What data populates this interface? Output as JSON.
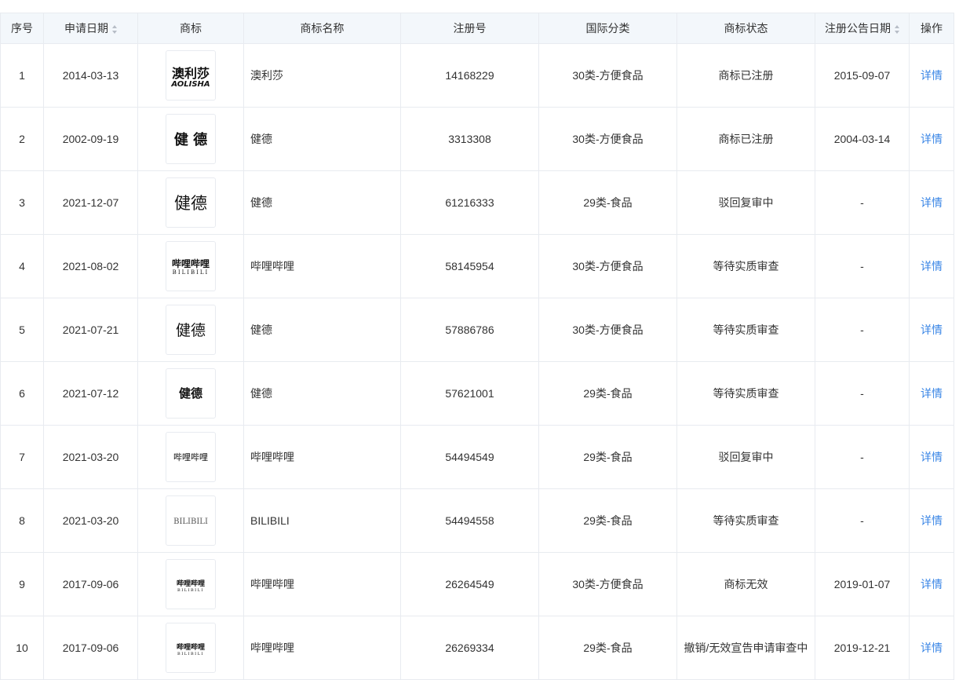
{
  "table": {
    "headers": {
      "index": "序号",
      "apply_date": "申请日期",
      "logo": "商标",
      "name": "商标名称",
      "reg_no": "注册号",
      "class": "国际分类",
      "status": "商标状态",
      "notice_date": "注册公告日期",
      "action": "操作"
    },
    "rows": [
      {
        "index": "1",
        "apply_date": "2014-03-13",
        "logo": {
          "icon": "aolisha-logo",
          "line1": "澳利莎",
          "line2": "AOLISHA"
        },
        "name": "澳利莎",
        "reg_no": "14168229",
        "class": "30类-方便食品",
        "status": "商标已注册",
        "notice_date": "2015-09-07",
        "action": "详情"
      },
      {
        "index": "2",
        "apply_date": "2002-09-19",
        "logo": {
          "icon": "jiande-bold-spaced-logo",
          "line1": "健 德",
          "line2": ""
        },
        "name": "健德",
        "reg_no": "3313308",
        "class": "30类-方便食品",
        "status": "商标已注册",
        "notice_date": "2004-03-14",
        "action": "详情"
      },
      {
        "index": "3",
        "apply_date": "2021-12-07",
        "logo": {
          "icon": "jiande-large-logo",
          "line1": "健德",
          "line2": ""
        },
        "name": "健德",
        "reg_no": "61216333",
        "class": "29类-食品",
        "status": "驳回复审中",
        "notice_date": "-",
        "action": "详情"
      },
      {
        "index": "4",
        "apply_date": "2021-08-02",
        "logo": {
          "icon": "bilibili-bold-logo",
          "line1": "哔哩哔哩",
          "line2": "BILIBILI"
        },
        "name": "哔哩哔哩",
        "reg_no": "58145954",
        "class": "30类-方便食品",
        "status": "等待实质审查",
        "notice_date": "-",
        "action": "详情"
      },
      {
        "index": "5",
        "apply_date": "2021-07-21",
        "logo": {
          "icon": "jiande-serif-logo",
          "line1": "健德",
          "line2": ""
        },
        "name": "健德",
        "reg_no": "57886786",
        "class": "30类-方便食品",
        "status": "等待实质审查",
        "notice_date": "-",
        "action": "详情"
      },
      {
        "index": "6",
        "apply_date": "2021-07-12",
        "logo": {
          "icon": "jiande-small-logo",
          "line1": "健德",
          "line2": ""
        },
        "name": "健德",
        "reg_no": "57621001",
        "class": "29类-食品",
        "status": "等待实质审查",
        "notice_date": "-",
        "action": "详情"
      },
      {
        "index": "7",
        "apply_date": "2021-03-20",
        "logo": {
          "icon": "bilibili-serif-logo",
          "line1": "哔哩哔哩",
          "line2": ""
        },
        "name": "哔哩哔哩",
        "reg_no": "54494549",
        "class": "29类-食品",
        "status": "驳回复审中",
        "notice_date": "-",
        "action": "详情"
      },
      {
        "index": "8",
        "apply_date": "2021-03-20",
        "logo": {
          "icon": "bilibili-text-logo",
          "line1": "BILIBILI",
          "line2": ""
        },
        "name": "BILIBILI",
        "reg_no": "54494558",
        "class": "29类-食品",
        "status": "等待实质审查",
        "notice_date": "-",
        "action": "详情"
      },
      {
        "index": "9",
        "apply_date": "2017-09-06",
        "logo": {
          "icon": "bilibili-small-logo",
          "line1": "哔哩哔哩",
          "line2": "BILIBILI"
        },
        "name": "哔哩哔哩",
        "reg_no": "26264549",
        "class": "30类-方便食品",
        "status": "商标无效",
        "notice_date": "2019-01-07",
        "action": "详情"
      },
      {
        "index": "10",
        "apply_date": "2017-09-06",
        "logo": {
          "icon": "bilibili-small-logo",
          "line1": "哔哩哔哩",
          "line2": "BILIBILI"
        },
        "name": "哔哩哔哩",
        "reg_no": "26269334",
        "class": "29类-食品",
        "status": "撤销/无效宣告申请审查中",
        "notice_date": "2019-12-21",
        "action": "详情"
      }
    ]
  }
}
